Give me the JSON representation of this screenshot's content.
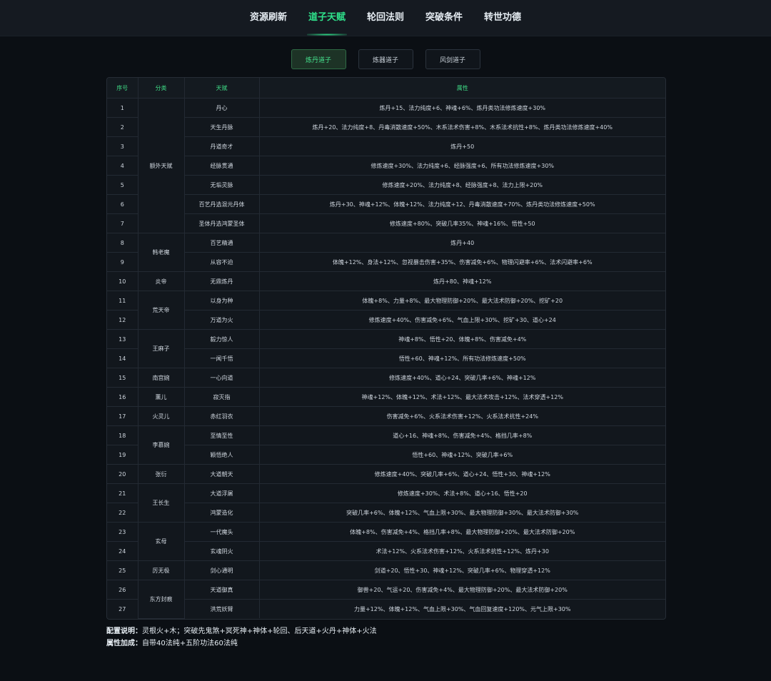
{
  "nav": [
    {
      "label": "资源刷新",
      "active": false
    },
    {
      "label": "道子天赋",
      "active": true
    },
    {
      "label": "轮回法则",
      "active": false
    },
    {
      "label": "突破条件",
      "active": false
    },
    {
      "label": "转世功德",
      "active": false
    }
  ],
  "subtabs": [
    {
      "label": "炼丹道子",
      "active": true
    },
    {
      "label": "炼器道子",
      "active": false
    },
    {
      "label": "风剑道子",
      "active": false
    }
  ],
  "table": {
    "headers": [
      "序号",
      "分类",
      "天赋",
      "属性"
    ],
    "groups": [
      {
        "category": "额外天赋",
        "rows": [
          {
            "no": "1",
            "talent": "丹心",
            "attr": "炼丹+15、法力纯度+6、神魂+6%、炼丹类功法修炼速度+30%"
          },
          {
            "no": "2",
            "talent": "天生丹脉",
            "attr": "炼丹+20、法力纯度+8、丹毒消散速度+50%、木系法术伤害+8%、木系法术抗性+8%、炼丹类功法修炼速度+40%"
          },
          {
            "no": "3",
            "talent": "丹道奇才",
            "attr": "炼丹+50"
          },
          {
            "no": "4",
            "talent": "经脉贯通",
            "attr": "修炼速度+30%、法力纯度+6、经脉强度+6、所有功法修炼速度+30%"
          },
          {
            "no": "5",
            "talent": "无垢灵脉",
            "attr": "修炼速度+20%、法力纯度+8、经脉强度+8、法力上限+20%"
          },
          {
            "no": "6",
            "talent": "百艺丹选混元丹体",
            "attr": "炼丹+30、神魂+12%、体魄+12%、法力纯度+12、丹毒消散速度+70%、炼丹类功法修炼速度+50%"
          },
          {
            "no": "7",
            "talent": "圣体丹选鸿蒙圣体",
            "attr": "修炼速度+80%、突破几率35%、神魂+16%、悟性+50"
          }
        ]
      },
      {
        "category": "韩老魔",
        "rows": [
          {
            "no": "8",
            "talent": "百艺精通",
            "attr": "炼丹+40"
          },
          {
            "no": "9",
            "talent": "从容不迫",
            "attr": "体魄+12%、身法+12%、忽视暴击伤害+35%、伤害减免+6%、物理闪避率+6%、法术闪避率+6%"
          }
        ]
      },
      {
        "category": "炎帝",
        "rows": [
          {
            "no": "10",
            "talent": "无鼎炼丹",
            "attr": "炼丹+80、神魂+12%"
          }
        ]
      },
      {
        "category": "荒天帝",
        "rows": [
          {
            "no": "11",
            "talent": "以身为种",
            "attr": "体魄+8%、力量+8%、最大物理防御+20%、最大法术防御+20%、挖矿+20"
          },
          {
            "no": "12",
            "talent": "万道为火",
            "attr": "修炼速度+40%、伤害减免+6%、气血上限+30%、挖矿+30、道心+24"
          }
        ]
      },
      {
        "category": "王麻子",
        "rows": [
          {
            "no": "13",
            "talent": "毅力惊人",
            "attr": "神魂+8%、悟性+20、体魄+8%、伤害减免+4%"
          },
          {
            "no": "14",
            "talent": "一闻千悟",
            "attr": "悟性+60、神魂+12%、所有功法修炼速度+50%"
          }
        ]
      },
      {
        "category": "南宫婉",
        "rows": [
          {
            "no": "15",
            "talent": "一心向道",
            "attr": "修炼速度+40%、道心+24、突破几率+6%、神魂+12%"
          }
        ]
      },
      {
        "category": "薰儿",
        "rows": [
          {
            "no": "16",
            "talent": "寂灭指",
            "attr": "神魂+12%、体魄+12%、术法+12%、最大法术攻击+12%、法术穿透+12%"
          }
        ]
      },
      {
        "category": "火灵儿",
        "rows": [
          {
            "no": "17",
            "talent": "赤红羽衣",
            "attr": "伤害减免+6%、火系法术伤害+12%、火系法术抗性+24%"
          }
        ]
      },
      {
        "category": "李慕婉",
        "rows": [
          {
            "no": "18",
            "talent": "至情至性",
            "attr": "道心+16、神魂+8%、伤害减免+4%、格挡几率+8%"
          },
          {
            "no": "19",
            "talent": "颖悟绝人",
            "attr": "悟性+60、神魂+12%、突破几率+6%"
          }
        ]
      },
      {
        "category": "张衍",
        "rows": [
          {
            "no": "20",
            "talent": "大道朝天",
            "attr": "修炼速度+40%、突破几率+6%、道心+24、悟性+30、神魂+12%"
          }
        ]
      },
      {
        "category": "王长生",
        "rows": [
          {
            "no": "21",
            "talent": "大道浮屠",
            "attr": "修炼速度+30%、术法+8%、道心+16、悟性+20"
          },
          {
            "no": "22",
            "talent": "鸿蒙造化",
            "attr": "突破几率+6%、体魄+12%、气血上限+30%、最大物理防御+30%、最大法术防御+30%"
          }
        ]
      },
      {
        "category": "玄母",
        "rows": [
          {
            "no": "23",
            "talent": "一代魔头",
            "attr": "体魄+8%、伤害减免+4%、格挡几率+8%、最大物理防御+20%、最大法术防御+20%"
          },
          {
            "no": "24",
            "talent": "玄魂阴火",
            "attr": "术法+12%、火系法术伤害+12%、火系法术抗性+12%、炼丹+30"
          }
        ]
      },
      {
        "category": "厉无极",
        "rows": [
          {
            "no": "25",
            "talent": "剑心通明",
            "attr": "剑道+20、悟性+30、神魂+12%、突破几率+6%、物理穿透+12%"
          }
        ]
      },
      {
        "category": "东方封痕",
        "rows": [
          {
            "no": "26",
            "talent": "天道御真",
            "attr": "御兽+20、气运+20、伤害减免+4%、最大物理防御+20%、最大法术防御+20%"
          },
          {
            "no": "27",
            "talent": "洪荒妖臂",
            "attr": "力量+12%、体魄+12%、气血上限+30%、气血回复速度+120%、元气上限+30%"
          }
        ]
      }
    ]
  },
  "notes": [
    {
      "label": "配置说明：",
      "text": "灵根火+木；突破先鬼煞+冥死神+神体+轮回、后天道+火丹+神体+火法"
    },
    {
      "label": "属性加成：",
      "text": "自带40法纯+五阶功法60法纯"
    }
  ]
}
